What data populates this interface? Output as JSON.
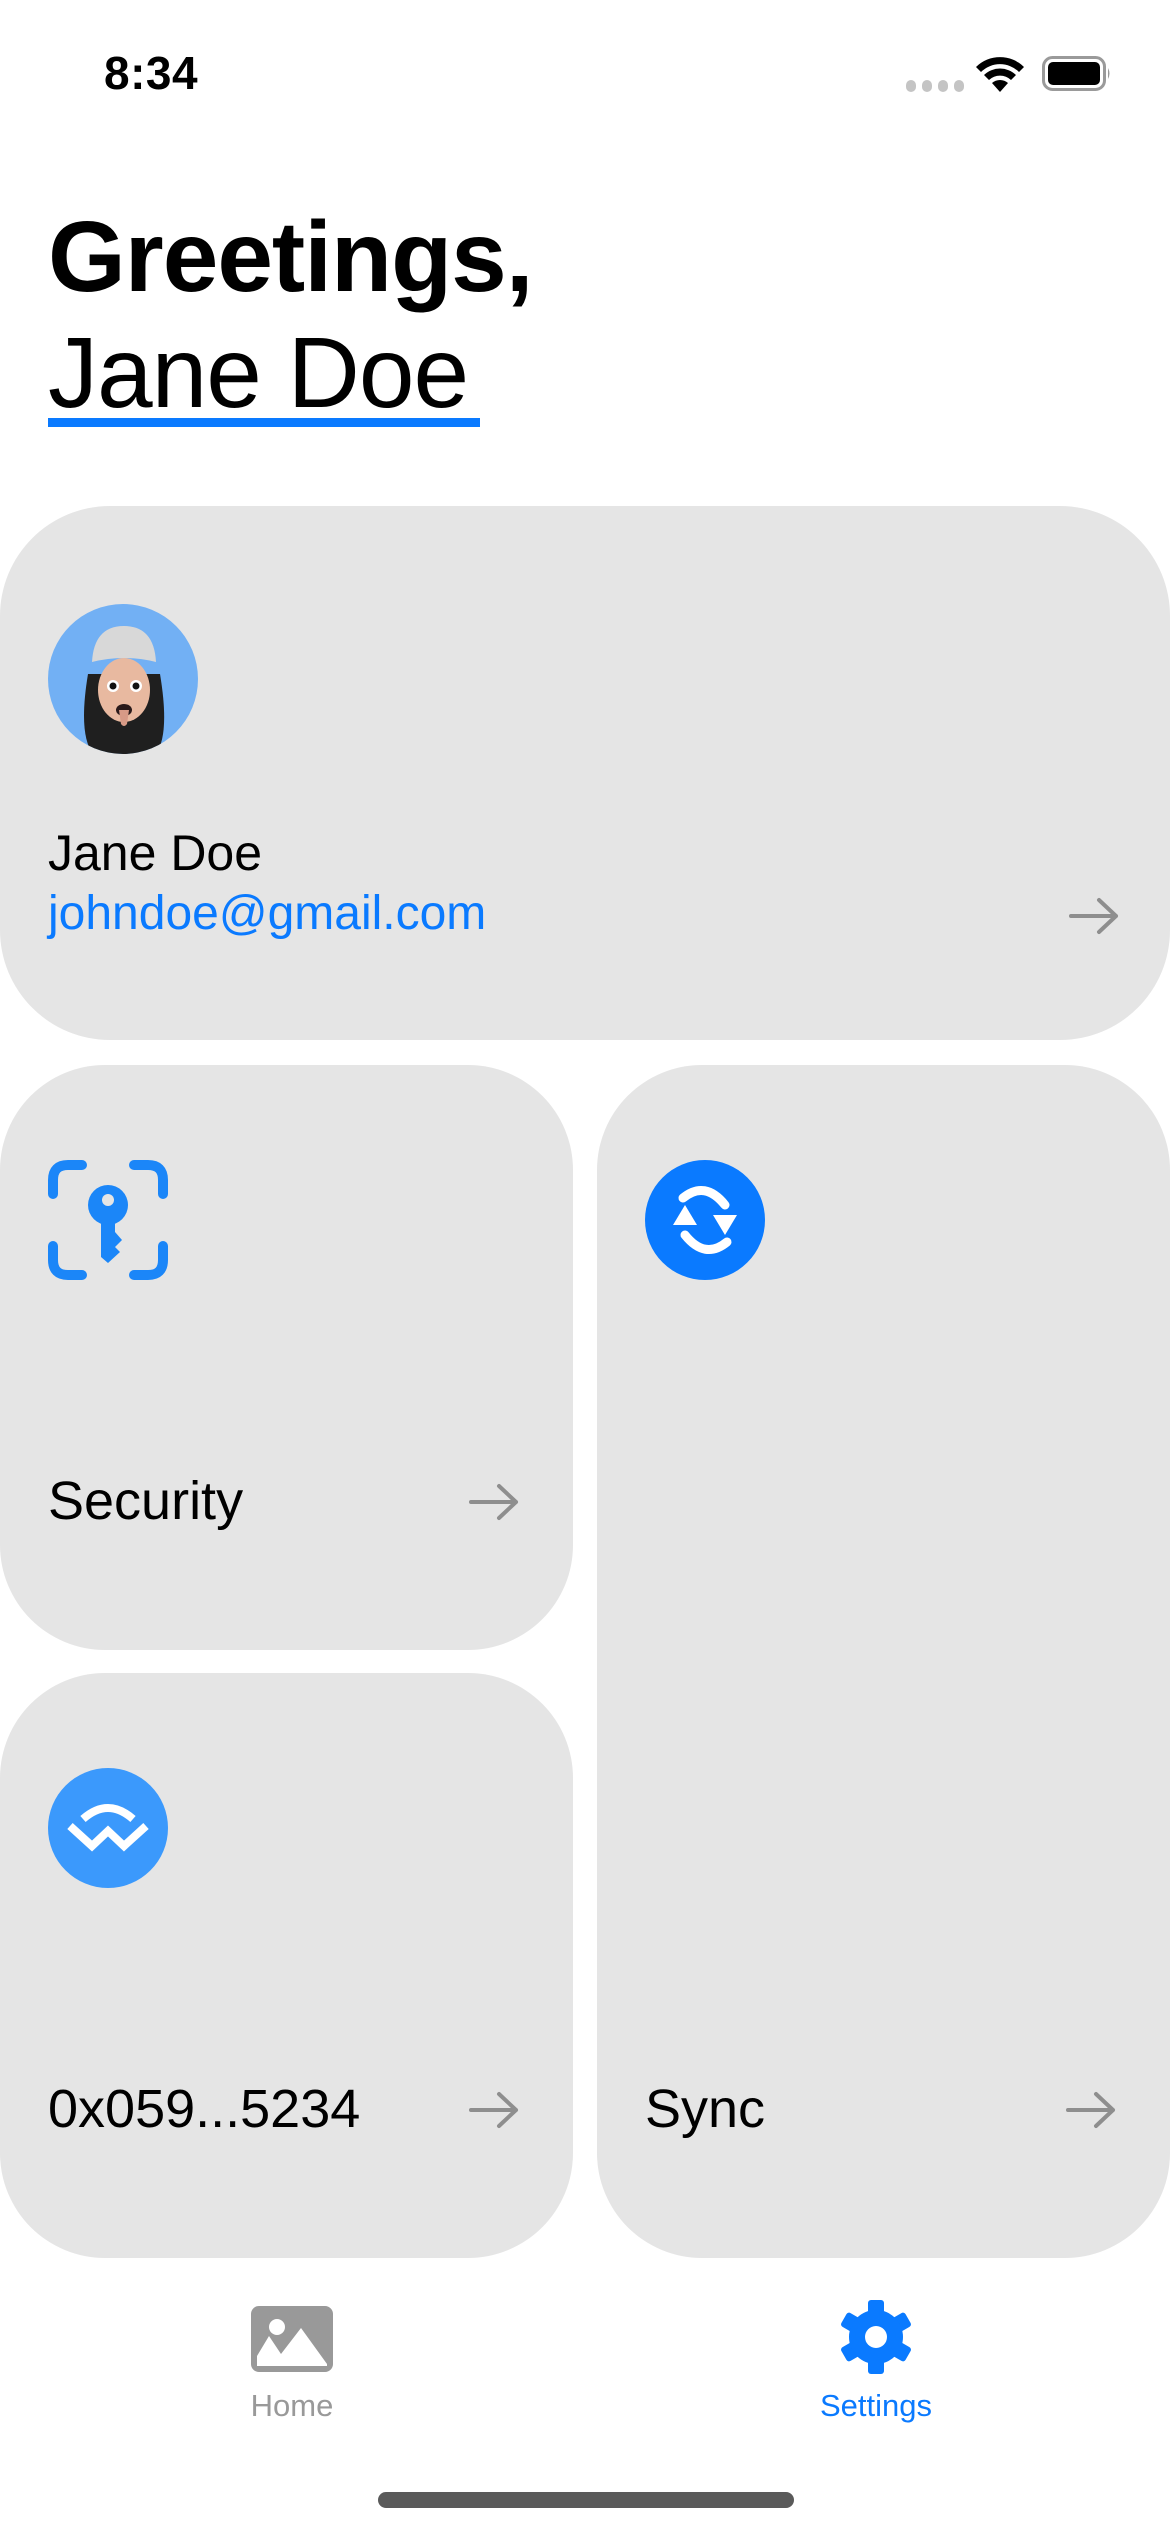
{
  "status_bar": {
    "time": "8:34",
    "signal_icon": "cellular-signal-icon",
    "wifi_icon": "wifi-icon",
    "battery_icon": "battery-icon"
  },
  "header": {
    "greeting": "Greetings,",
    "name": "Jane Doe"
  },
  "profile_card": {
    "avatar_icon": "memoji-avatar",
    "name": "Jane Doe",
    "email": "johndoe@gmail.com",
    "arrow_icon": "arrow-right-icon"
  },
  "cards": {
    "security": {
      "label": "Security",
      "icon": "key-viewfinder-icon",
      "arrow_icon": "arrow-right-icon"
    },
    "wallet": {
      "label": "0x059...5234",
      "icon": "walletconnect-icon",
      "arrow_icon": "arrow-right-icon"
    },
    "sync": {
      "label": "Sync",
      "icon": "sync-icon",
      "arrow_icon": "arrow-right-icon"
    }
  },
  "tab_bar": {
    "tabs": [
      {
        "label": "Home",
        "icon": "photo-icon",
        "active": false
      },
      {
        "label": "Settings",
        "icon": "gear-icon",
        "active": true
      }
    ]
  },
  "colors": {
    "accent": "#0a7aff",
    "card_background": "#e5e5e5",
    "inactive_tab": "#999999",
    "avatar_background": "#72b0f4",
    "walletconnect_blue": "#3b99fc"
  }
}
